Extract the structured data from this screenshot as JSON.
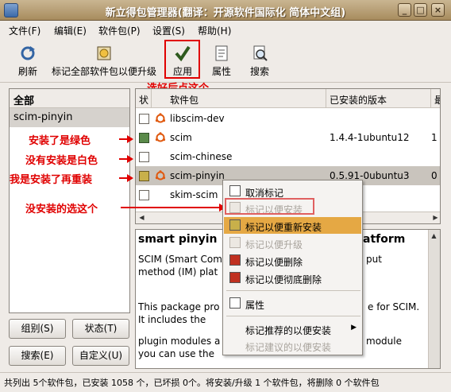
{
  "window": {
    "title": "新立得包管理器(翻译：开源软件国际化 简体中文组)",
    "min_label": "_",
    "max_label": "□",
    "close_label": "×"
  },
  "menu": [
    "文件(F)",
    "编辑(E)",
    "软件包(P)",
    "设置(S)",
    "帮助(H)"
  ],
  "toolbar": {
    "reload": "刷新",
    "mark_all": "标记全部软件包以便升级",
    "apply": "应用",
    "properties": "属性",
    "search": "搜索"
  },
  "annotations": {
    "apply_hint": "选好后点这个",
    "green_hint": "安装了是绿色",
    "white_hint": "没有安装是白色",
    "reinstall_hint": "我是安装了再重装",
    "select_hint": "没安装的选这个"
  },
  "left_panel": {
    "header": "全部",
    "selected_item": "scim-pinyin"
  },
  "buttons": {
    "sections": "组别(S)",
    "status": "状态(T)",
    "search": "搜索(E)",
    "custom": "自定义(U)"
  },
  "package_list": {
    "columns": [
      "状",
      "软件包",
      "已安装的版本",
      "最"
    ],
    "rows": [
      {
        "status": "none",
        "name": "libscim-dev",
        "installed": "",
        "latest": ""
      },
      {
        "status": "installed",
        "name": "scim",
        "installed": "1.4.4-1ubuntu12",
        "latest": "1"
      },
      {
        "status": "none",
        "name": "scim-chinese",
        "installed": "",
        "latest": ""
      },
      {
        "status": "reinstall",
        "name": "scim-pinyin",
        "installed": "0.5.91-0ubuntu3",
        "latest": "0"
      },
      {
        "status": "none",
        "name": "skim-scim",
        "installed": "",
        "latest": ""
      }
    ],
    "colors": {
      "installed": "#5a8a4a",
      "reinstall": "#c8b04a"
    }
  },
  "description": {
    "title": "smart pinyin",
    "title_tail": "atform",
    "lines": [
      "SCIM (Smart Com",
      "method (IM) plat",
      "",
      "This package pro",
      "It includes the",
      "",
      "plugin modules a",
      "you can use the"
    ],
    "right_fragments": [
      "put",
      "e for SCIM.",
      "module"
    ]
  },
  "context_menu": {
    "items": [
      {
        "label": "取消标记",
        "state": "normal",
        "icon": "unmark-icon"
      },
      {
        "label": "标记以便安装",
        "state": "disabled",
        "icon": "install-icon"
      },
      {
        "label": "标记以便重新安装",
        "state": "highlighted",
        "icon": "reinstall-icon"
      },
      {
        "label": "标记以便升级",
        "state": "disabled",
        "icon": "upgrade-icon"
      },
      {
        "label": "标记以便删除",
        "state": "normal",
        "icon": "remove-icon"
      },
      {
        "label": "标记以便彻底删除",
        "state": "normal",
        "icon": "purge-icon"
      },
      {
        "label": "属性",
        "state": "normal",
        "icon": "properties-icon"
      },
      {
        "label": "标记推荐的以便安装",
        "state": "normal",
        "icon": ""
      },
      {
        "label": "标记建议的以便安装",
        "state": "disabled",
        "icon": ""
      }
    ],
    "accent": "#e5a844"
  },
  "statusbar": {
    "text": "共列出 5个软件包，已安装 1058 个，已坏损 0个。将安装/升级 1 个软件包，将删除 0 个软件包"
  }
}
